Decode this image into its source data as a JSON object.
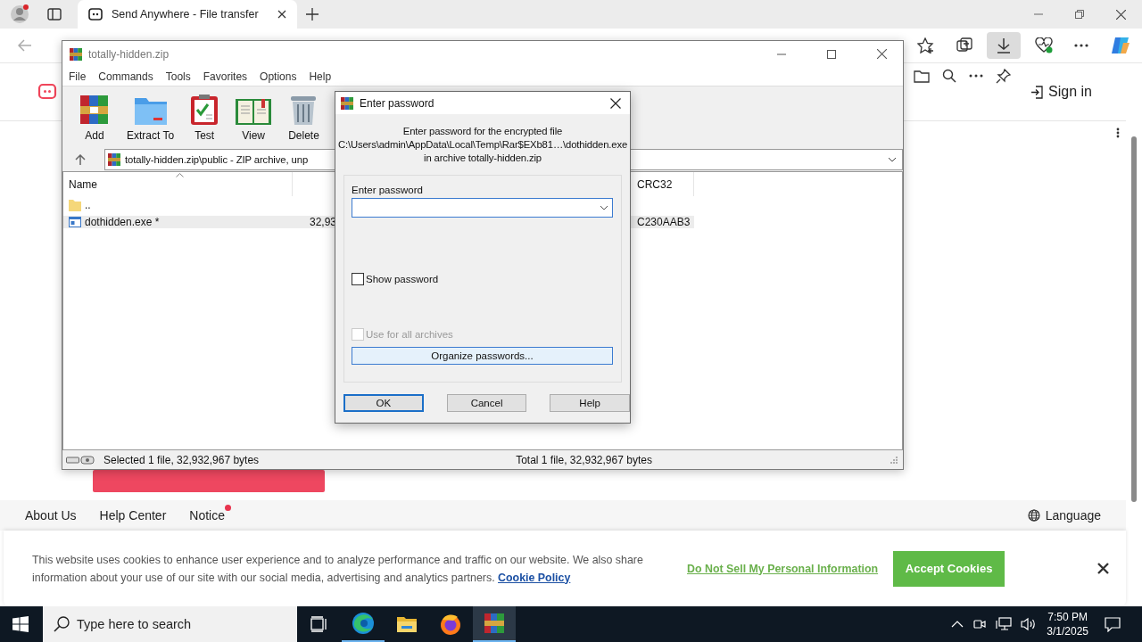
{
  "browser": {
    "tab": {
      "title": "Send Anywhere - File transfer"
    },
    "page": {
      "sign_in": "Sign in",
      "footer_links": [
        {
          "label": "About Us",
          "badge": false
        },
        {
          "label": "Help Center",
          "badge": false
        },
        {
          "label": "Notice",
          "badge": true
        }
      ],
      "language": "Language"
    },
    "cookie_banner": {
      "text": "This website uses cookies to enhance user experience and to analyze performance and traffic on our website. We also share information about your use of our site with our social media, advertising and analytics partners.",
      "policy_link": "Cookie Policy",
      "do_not_sell": "Do Not Sell My Personal Information",
      "accept": "Accept Cookies"
    }
  },
  "winrar": {
    "title": "totally-hidden.zip",
    "menu": [
      "File",
      "Commands",
      "Tools",
      "Favorites",
      "Options",
      "Help"
    ],
    "tools": [
      {
        "label": "Add",
        "kind": "add"
      },
      {
        "label": "Extract To",
        "kind": "extract"
      },
      {
        "label": "Test",
        "kind": "test"
      },
      {
        "label": "View",
        "kind": "view"
      },
      {
        "label": "Delete",
        "kind": "delete"
      }
    ],
    "path": "totally-hidden.zip\\public - ZIP archive, unp",
    "columns": {
      "name": "Name",
      "crc": "CRC32"
    },
    "rows": [
      {
        "name": "..",
        "kind": "folder",
        "selected": false
      },
      {
        "name": "dothidden.exe *",
        "kind": "file",
        "size": "32,93",
        "crc": "C230AAB3",
        "selected": true
      }
    ],
    "status": {
      "selected": "Selected 1 file, 32,932,967 bytes",
      "total": "Total 1 file, 32,932,967 bytes"
    }
  },
  "dialog": {
    "title": "Enter password",
    "message": [
      "Enter password for the encrypted file",
      "C:\\Users\\admin\\AppData\\Local\\Temp\\Rar$EXb81…\\dothidden.exe",
      "in archive totally-hidden.zip"
    ],
    "field_label": "Enter password",
    "checkboxes": [
      {
        "label": "Show password",
        "checked": false,
        "disabled": false
      },
      {
        "label": "Use for all archives",
        "checked": false,
        "disabled": true
      }
    ],
    "organize": "Organize passwords...",
    "buttons": [
      {
        "label": "OK",
        "default": true
      },
      {
        "label": "Cancel",
        "default": false
      },
      {
        "label": "Help",
        "default": false
      }
    ]
  },
  "taskbar": {
    "search_placeholder": "Type here to search",
    "apps": [
      {
        "kind": "edge",
        "running": true,
        "selected": false
      },
      {
        "kind": "explorer",
        "running": false,
        "selected": false
      },
      {
        "kind": "firefox",
        "running": false,
        "selected": false
      },
      {
        "kind": "winrar",
        "running": true,
        "selected": true
      }
    ],
    "time": "7:50 PM",
    "date": "3/1/2025"
  }
}
